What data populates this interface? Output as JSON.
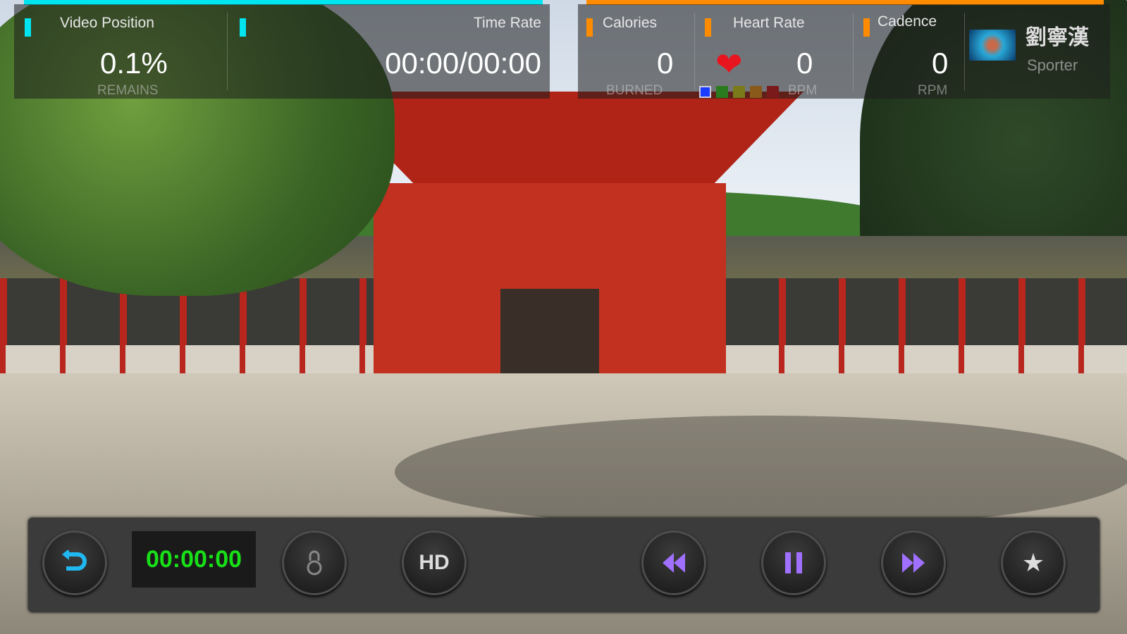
{
  "stats_left": {
    "video_position": {
      "label": "Video Position",
      "value": "0.1%",
      "unit": "REMAINS"
    },
    "time_rate": {
      "label": "Time Rate",
      "value": "00:00/00:00"
    }
  },
  "stats_right": {
    "calories": {
      "label": "Calories",
      "value": "0",
      "unit": "BURNED"
    },
    "heart_rate": {
      "label": "Heart Rate",
      "value": "0",
      "unit": "BPM",
      "zones": [
        "#1a3cff",
        "#2a7a1e",
        "#7a7a1a",
        "#8a5a1a",
        "#7a1a1a"
      ]
    },
    "cadence": {
      "label": "Cadence",
      "value": "0",
      "unit": "RPM"
    },
    "user": {
      "name": "劉寧漢",
      "role": "Sporter"
    }
  },
  "controls": {
    "elapsed": "00:00:00",
    "hd_label": "HD"
  },
  "colors": {
    "cyan": "#00e5f0",
    "orange": "#ff8c00",
    "heart": "#e8141e",
    "clock": "#18e018",
    "accent_purple": "#a070ff",
    "back_blue": "#20b8f0"
  }
}
